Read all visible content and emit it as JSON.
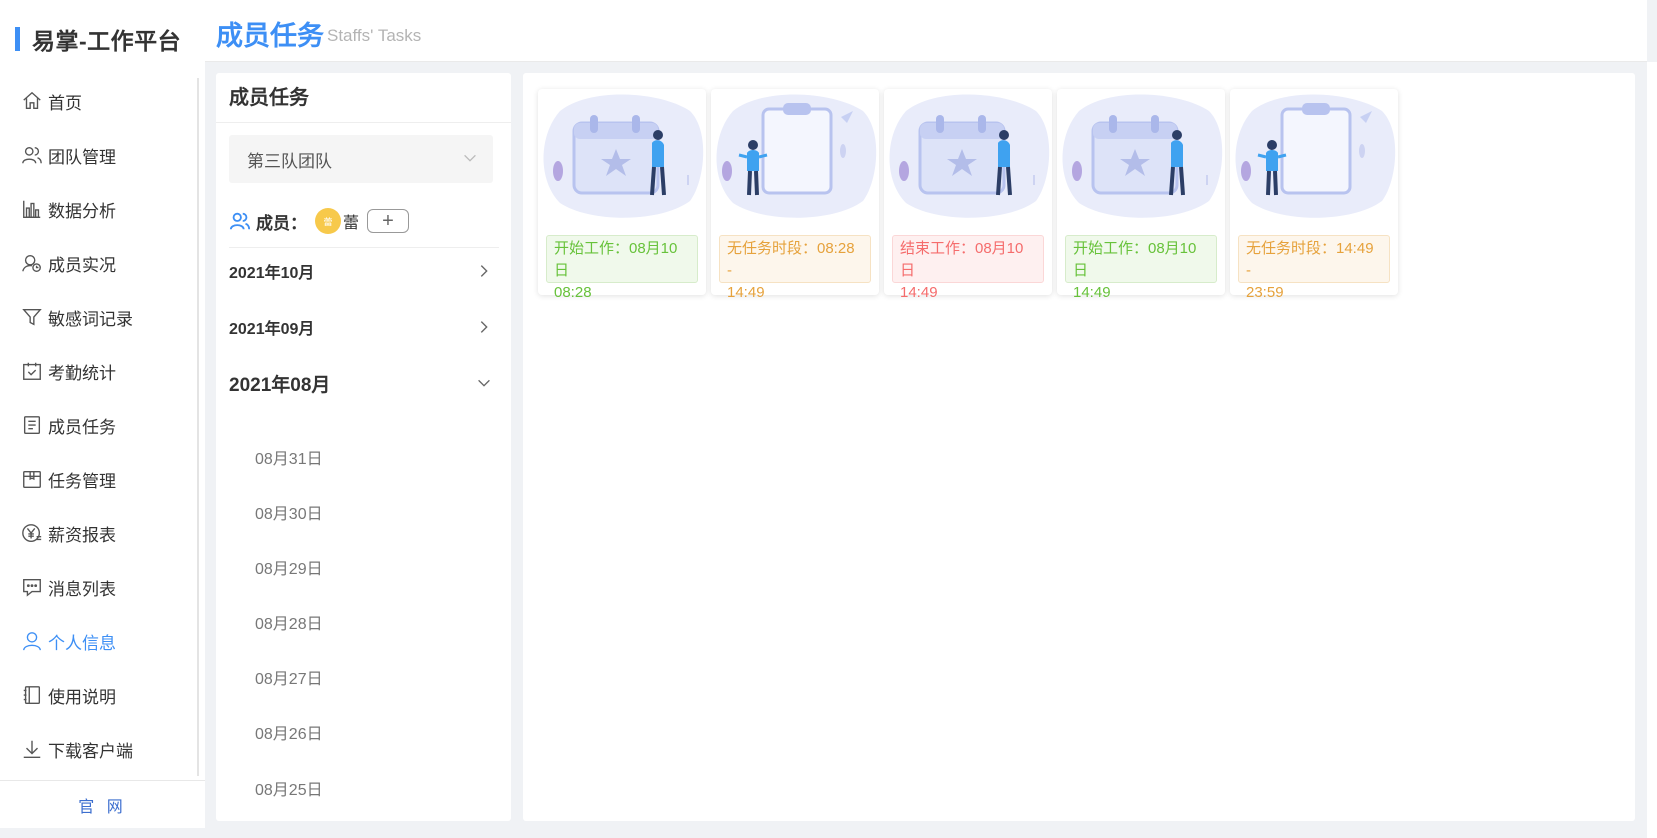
{
  "app": {
    "brand": "易掌-工作平台",
    "official_site": "官 网"
  },
  "colors": {
    "accent": "#3d8ff5",
    "green": "#67c23a",
    "orange": "#e6a23c",
    "red": "#f56c6c"
  },
  "sidebar": {
    "items": [
      {
        "label": "首页",
        "icon": "home-icon"
      },
      {
        "label": "团队管理",
        "icon": "team-icon"
      },
      {
        "label": "数据分析",
        "icon": "bar-chart-icon"
      },
      {
        "label": "成员实况",
        "icon": "member-status-icon"
      },
      {
        "label": "敏感词记录",
        "icon": "filter-icon"
      },
      {
        "label": "考勤统计",
        "icon": "calendar-check-icon"
      },
      {
        "label": "成员任务",
        "icon": "task-list-icon"
      },
      {
        "label": "任务管理",
        "icon": "box-icon"
      },
      {
        "label": "薪资报表",
        "icon": "yuan-icon"
      },
      {
        "label": "消息列表",
        "icon": "message-icon"
      },
      {
        "label": "个人信息",
        "icon": "user-icon",
        "active": true
      },
      {
        "label": "使用说明",
        "icon": "notebook-icon"
      },
      {
        "label": "下载客户端",
        "icon": "download-icon"
      }
    ]
  },
  "header": {
    "title": "成员任务",
    "subtitle": "Staffs' Tasks"
  },
  "panel": {
    "title": "成员任务",
    "team_selected": "第三队团队",
    "members_label": "成员：",
    "member": {
      "avatar_text": "蕾",
      "name": "蕾"
    },
    "add_symbol": "+",
    "months": [
      {
        "label": "2021年10月",
        "expanded": false
      },
      {
        "label": "2021年09月",
        "expanded": false
      },
      {
        "label": "2021年08月",
        "expanded": true
      }
    ],
    "days": [
      "08月31日",
      "08月30日",
      "08月29日",
      "08月28日",
      "08月27日",
      "08月26日",
      "08月25日"
    ]
  },
  "tasks": [
    {
      "illustration": "calendar-person-illustration",
      "status": "green",
      "line1": "开始工作：08月10日",
      "line2": "08:28"
    },
    {
      "illustration": "clipboard-person-illustration",
      "status": "orange",
      "line1": "无任务时段：08:28 -",
      "line2": "14:49"
    },
    {
      "illustration": "calendar-person-illustration",
      "status": "red",
      "line1": "结束工作：08月10日",
      "line2": "14:49"
    },
    {
      "illustration": "calendar-person-illustration",
      "status": "green",
      "line1": "开始工作：08月10日",
      "line2": "14:49"
    },
    {
      "illustration": "clipboard-person-illustration",
      "status": "orange",
      "line1": "无任务时段：14:49 -",
      "line2": "23:59"
    }
  ]
}
